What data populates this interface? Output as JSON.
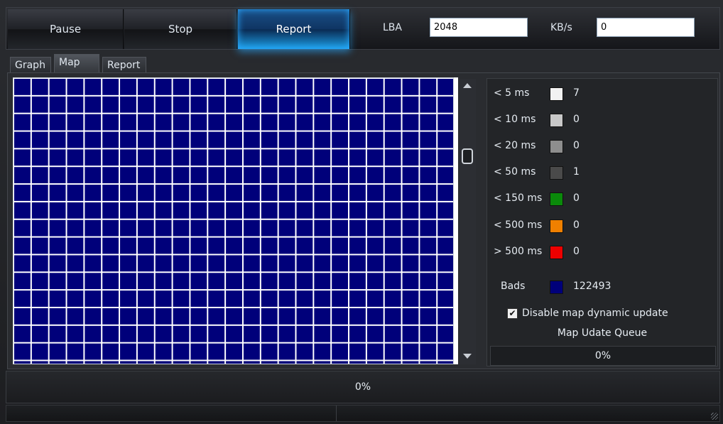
{
  "toolbar": {
    "pause_label": "Pause",
    "stop_label": "Stop",
    "report_label": "Report",
    "lba_label": "LBA",
    "lba_value": "2048",
    "kbs_label": "KB/s",
    "kbs_value": "0"
  },
  "tabs": [
    {
      "label": "Graph",
      "active": false
    },
    {
      "label": "Map",
      "active": true
    },
    {
      "label": "Report",
      "active": false
    }
  ],
  "legend": {
    "items": [
      {
        "label": "< 5 ms",
        "color": "#f2f2f2",
        "count": "7"
      },
      {
        "label": "< 10 ms",
        "color": "#c8c8c8",
        "count": "0"
      },
      {
        "label": "< 20 ms",
        "color": "#8e8e8e",
        "count": "0"
      },
      {
        "label": "< 50 ms",
        "color": "#4a4a4a",
        "count": "1"
      },
      {
        "label": "< 150 ms",
        "color": "#0a8a0a",
        "count": "0"
      },
      {
        "label": "< 500 ms",
        "color": "#f08000",
        "count": "0"
      },
      {
        "label": "> 500 ms",
        "color": "#ee0000",
        "count": "0"
      }
    ],
    "bads": {
      "label": "Bads",
      "color": "#00007a",
      "count": "122493"
    },
    "disable_update_label": "Disable map dynamic update",
    "disable_update_checked": true,
    "queue_title": "Map Udate Queue",
    "queue_progress": "0%"
  },
  "map": {
    "block_color": "#00007a",
    "grid_color": "#ffffff"
  },
  "progress": {
    "text": "0%"
  }
}
